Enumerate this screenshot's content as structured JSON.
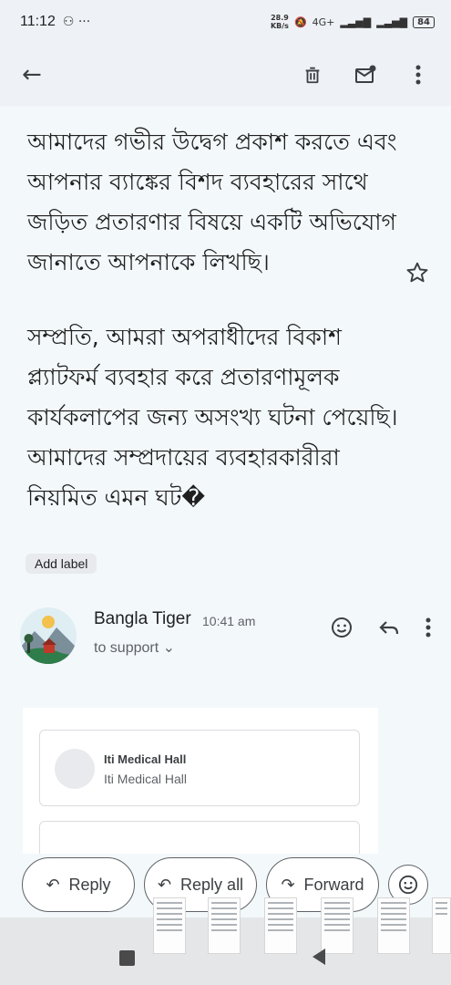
{
  "status_bar": {
    "time": "11:12",
    "speed_value": "28.9",
    "speed_unit": "KB/s",
    "network": "4G+",
    "battery": "84"
  },
  "app_bar": {
    "back_icon": "arrow-left-icon",
    "delete_icon": "trash-icon",
    "mark_unread_icon": "mail-unread-icon",
    "more_icon": "more-vert-icon"
  },
  "message": {
    "paragraphs": [
      "আমাদের গভীর উদ্বেগ প্রকাশ করতে এবং আপনার ব্যাঙ্কের বিশদ ব্যবহারের সাথে জড়িত প্রতারণার বিষয়ে একটি অভিযোগ জানাতে আপনাকে লিখছি।",
      "সম্প্রতি, আমরা অপরাধীদের বিকাশ প্ল্যাটফর্ম ব্যবহার করে প্রতারণামূলক কার্যকলাপের জন্য অসংখ্য ঘটনা পেয়েছি। আমাদের সম্প্রদায়ের ব্যবহারকারীরা নিয়মিত এমন ঘট�"
    ],
    "add_label": "Add label"
  },
  "sender": {
    "name": "Bangla Tiger",
    "time": "10:41 am",
    "to": "to support"
  },
  "embedded": {
    "name": "Iti Medical Hall",
    "subtitle": "Iti Medical Hall"
  },
  "actions": {
    "reply": "Reply",
    "reply_all": "Reply all",
    "forward": "Forward"
  },
  "colors": {
    "bar_bg": "#eef2f6",
    "content_bg": "#f3f8fb",
    "icon": "#3c4043"
  }
}
